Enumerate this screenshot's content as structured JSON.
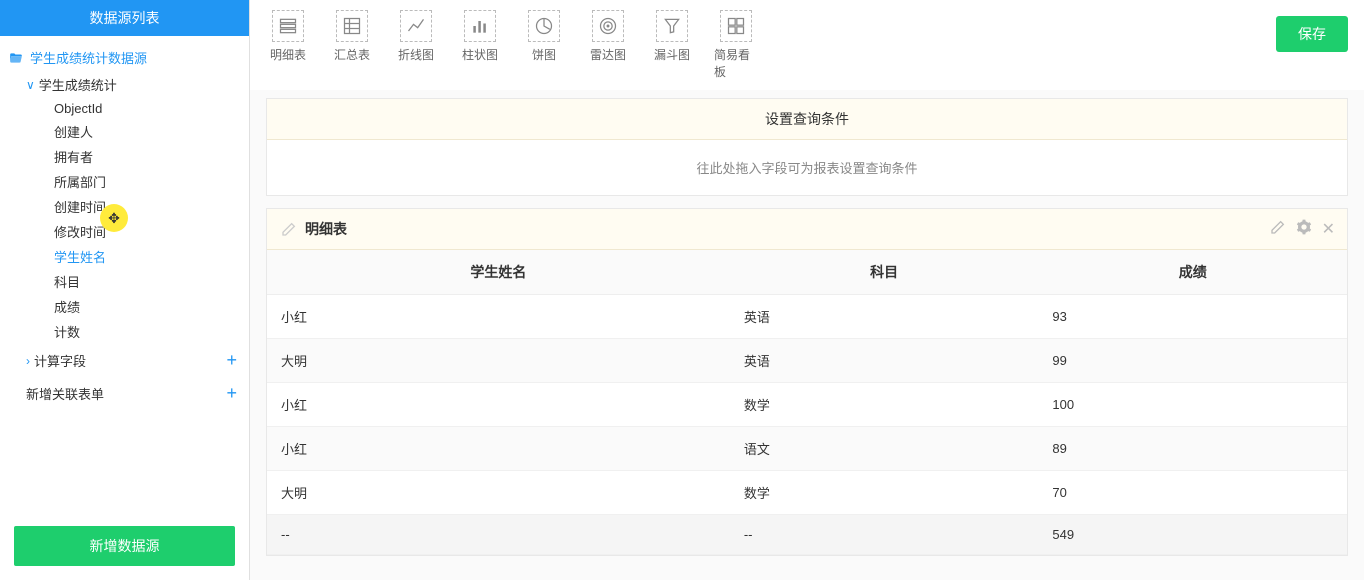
{
  "sidebar": {
    "title": "数据源列表",
    "root": "学生成绩统计数据源",
    "node1": "学生成绩统计",
    "fields": [
      "ObjectId",
      "创建人",
      "拥有者",
      "所属部门",
      "创建时间",
      "修改时间",
      "学生姓名",
      "科目",
      "成绩",
      "计数"
    ],
    "activeIndex": 6,
    "calc": "计算字段",
    "addform": "新增关联表单",
    "addButton": "新增数据源"
  },
  "toolbar": {
    "types": [
      "明细表",
      "汇总表",
      "折线图",
      "柱状图",
      "饼图",
      "雷达图",
      "漏斗图",
      "简易看板"
    ],
    "save": "保存"
  },
  "queryPanel": {
    "title": "设置查询条件",
    "placeholder": "往此处拖入字段可为报表设置查询条件"
  },
  "detailPanel": {
    "title": "明细表",
    "columns": [
      "学生姓名",
      "科目",
      "成绩"
    ],
    "rows": [
      [
        "小红",
        "英语",
        "93"
      ],
      [
        "大明",
        "英语",
        "99"
      ],
      [
        "小红",
        "数学",
        "100"
      ],
      [
        "小红",
        "语文",
        "89"
      ],
      [
        "大明",
        "数学",
        "70"
      ],
      [
        "--",
        "--",
        "549"
      ]
    ]
  },
  "chart_data": {
    "type": "table",
    "title": "明细表",
    "columns": [
      "学生姓名",
      "科目",
      "成绩"
    ],
    "rows": [
      {
        "学生姓名": "小红",
        "科目": "英语",
        "成绩": 93
      },
      {
        "学生姓名": "大明",
        "科目": "英语",
        "成绩": 99
      },
      {
        "学生姓名": "小红",
        "科目": "数学",
        "成绩": 100
      },
      {
        "学生姓名": "小红",
        "科目": "语文",
        "成绩": 89
      },
      {
        "学生姓名": "大明",
        "科目": "数学",
        "成绩": 70
      }
    ],
    "total": {
      "成绩": 549
    }
  }
}
